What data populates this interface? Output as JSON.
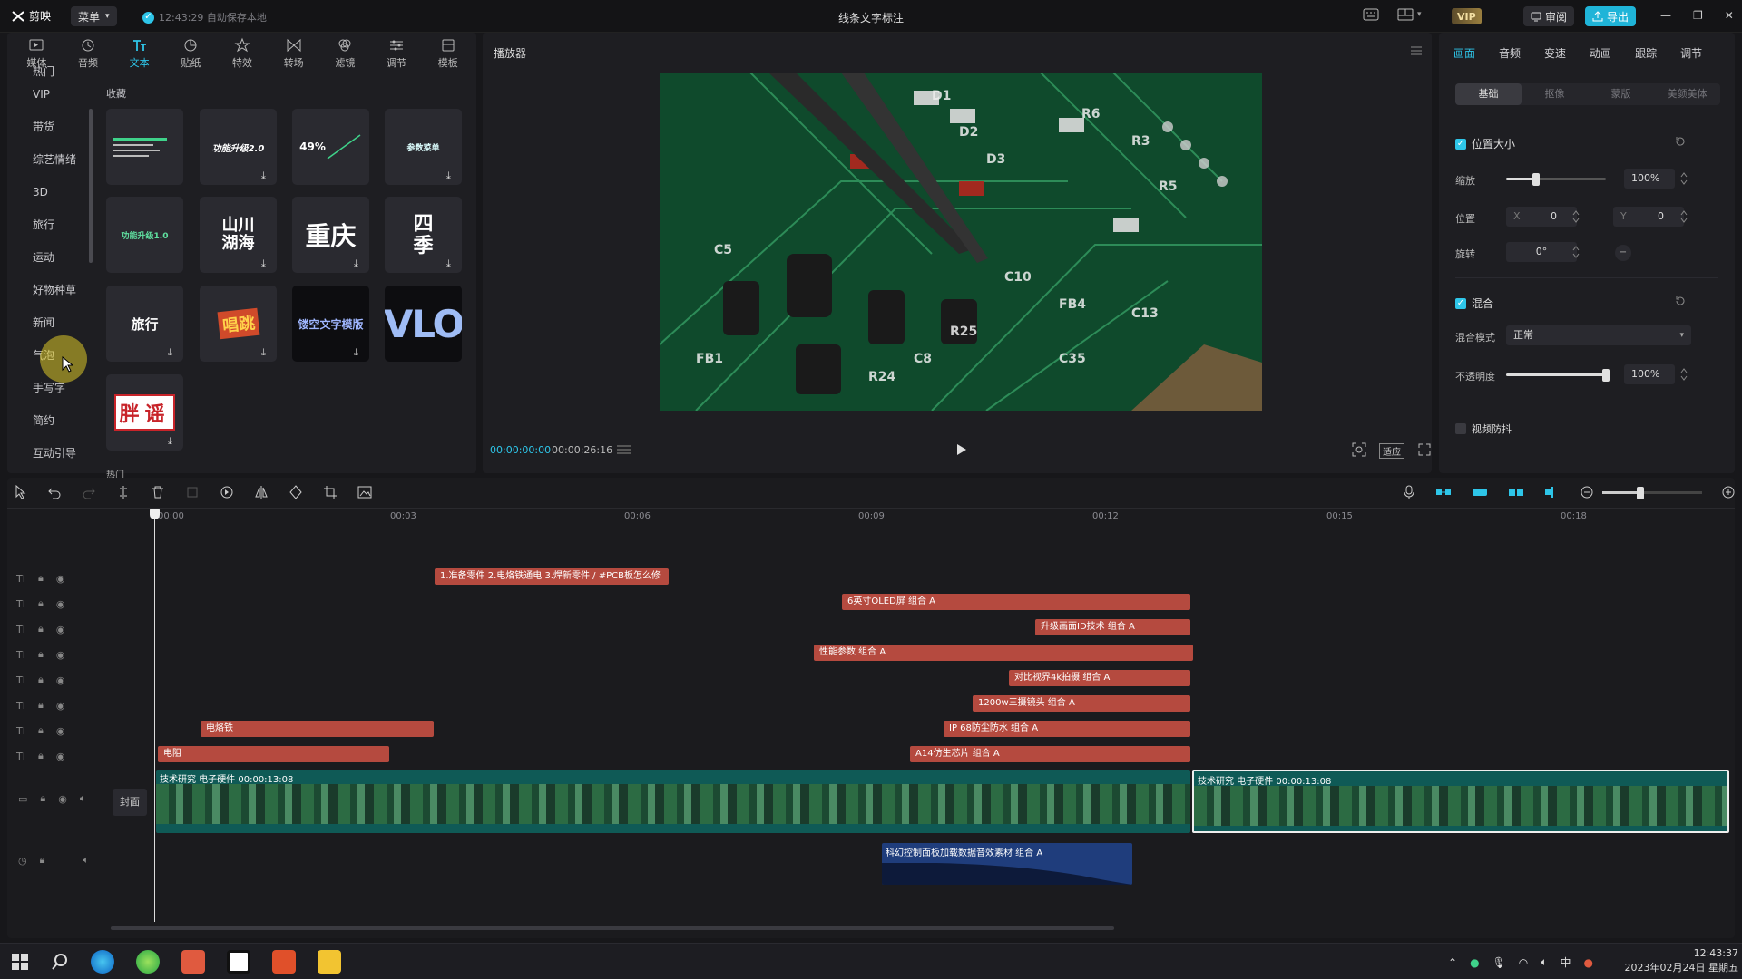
{
  "app": {
    "name": "剪映",
    "menu_label": "菜单",
    "autosave": "12:43:29 自动保存本地",
    "project_title": "线条文字标注",
    "vip": "VIP",
    "review": "审阅",
    "export": "导出"
  },
  "tool_tabs": [
    {
      "label": "媒体",
      "icon": "media-icon"
    },
    {
      "label": "音频",
      "icon": "audio-icon"
    },
    {
      "label": "文本",
      "icon": "text-icon",
      "active": true
    },
    {
      "label": "贴纸",
      "icon": "sticker-icon"
    },
    {
      "label": "特效",
      "icon": "effects-icon"
    },
    {
      "label": "转场",
      "icon": "transition-icon"
    },
    {
      "label": "滤镜",
      "icon": "filter-icon"
    },
    {
      "label": "调节",
      "icon": "adjust-icon"
    },
    {
      "label": "模板",
      "icon": "template-icon"
    }
  ],
  "categories": [
    "热门",
    "VIP",
    "带货",
    "综艺情绪",
    "3D",
    "旅行",
    "运动",
    "好物种草",
    "新闻",
    "气泡",
    "手写字",
    "简约",
    "互动引导"
  ],
  "library": {
    "section_favorites": "收藏",
    "section_hot": "热门",
    "tiles": [
      {
        "text": "",
        "style": "list"
      },
      {
        "text": "功能升级2.0",
        "style": "green"
      },
      {
        "text": "49%",
        "style": "green-line"
      },
      {
        "text": "参数菜单",
        "style": "green-small"
      },
      {
        "text": "功能升级1.0",
        "style": "green"
      },
      {
        "text": "山川湖海",
        "style": "brush"
      },
      {
        "text": "重庆",
        "style": "big"
      },
      {
        "text": "四季",
        "style": "brush"
      },
      {
        "text": "旅行",
        "style": "brush-small"
      },
      {
        "text": "唱跳",
        "style": "orange"
      },
      {
        "text": "镂空文字模版",
        "style": "hollow"
      },
      {
        "text": "VLO",
        "style": "vlog"
      },
      {
        "text": "胖谣",
        "style": "red-seal"
      }
    ]
  },
  "player": {
    "title": "播放器",
    "time_current": "00:00:00:00",
    "time_total": "00:00:26:16"
  },
  "inspector": {
    "tabs": [
      "画面",
      "音频",
      "变速",
      "动画",
      "跟踪",
      "调节"
    ],
    "subtabs": [
      "基础",
      "抠像",
      "蒙版",
      "美颜美体"
    ],
    "position_size": "位置大小",
    "scale_label": "缩放",
    "scale_value": "100%",
    "scale_level": 0.3,
    "position_label": "位置",
    "x_label": "X",
    "x_value": "0",
    "y_label": "Y",
    "y_value": "0",
    "rotate_label": "旋转",
    "rotate_value": "0°",
    "blend": "混合",
    "blend_mode_label": "混合模式",
    "blend_mode_value": "正常",
    "opacity_label": "不透明度",
    "opacity_value": "100%",
    "opacity_level": 1.0,
    "stabilize": "视频防抖"
  },
  "timeline": {
    "ticks": [
      "00:00",
      "00:03",
      "00:06",
      "00:09",
      "00:12",
      "00:15",
      "00:18"
    ],
    "text_clips": [
      "1.准备零件 2.电烙铁通电 3.焊新零件 / #PCB板怎么修",
      "6英寸OLED屏  组合 A",
      "升级画面ID技术  组合 A",
      "性能参数  组合 A",
      "对比视界4k拍摄  组合 A",
      "1200w三摄镜头  组合 A",
      "电烙铁",
      "IP 68防尘防水  组合 A",
      "电阻",
      "A14仿生芯片  组合 A"
    ],
    "cover_label": "封面",
    "video_clip_1": "技术研究 电子硬件   00:00:13:08",
    "video_clip_2": "技术研究 电子硬件   00:00:13:08",
    "audio_clip": "科幻控制面板加载数据音效素材   组合 A"
  },
  "taskbar": {
    "time": "12:43:37",
    "date": "2023年02月24日 星期五"
  },
  "colors": {
    "accent": "#2ec6e9",
    "text_clip": "#b54a3f",
    "video_clip": "#0f5a56",
    "audio_clip": "#1f3d7c"
  }
}
